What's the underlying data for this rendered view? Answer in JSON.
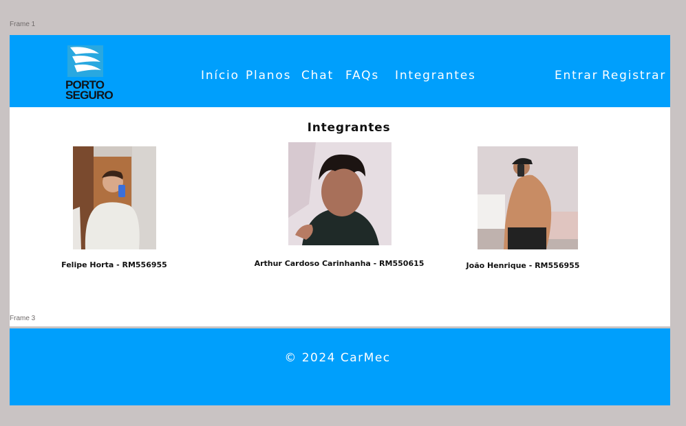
{
  "canvas": {
    "frame1_label": "Frame 1",
    "frame3_label": "Frame 3"
  },
  "header": {
    "logo_line1": "PORTO",
    "logo_line2": "SEGURO",
    "nav": [
      "Início",
      "Planos",
      "Chat",
      "FAQs",
      "Integrantes"
    ],
    "auth": [
      "Entrar",
      "Registrar"
    ]
  },
  "main": {
    "title": "Integrantes",
    "members": [
      {
        "name": "Felipe Horta - RM556955"
      },
      {
        "name": "Arthur Cardoso Carinhanha - RM550615"
      },
      {
        "name": "João Henrique - RM556955"
      }
    ]
  },
  "footer": {
    "text": "© 2024 CarMec"
  },
  "colors": {
    "brand_blue": "#009ffc",
    "canvas_bg": "#c9c3c3"
  }
}
